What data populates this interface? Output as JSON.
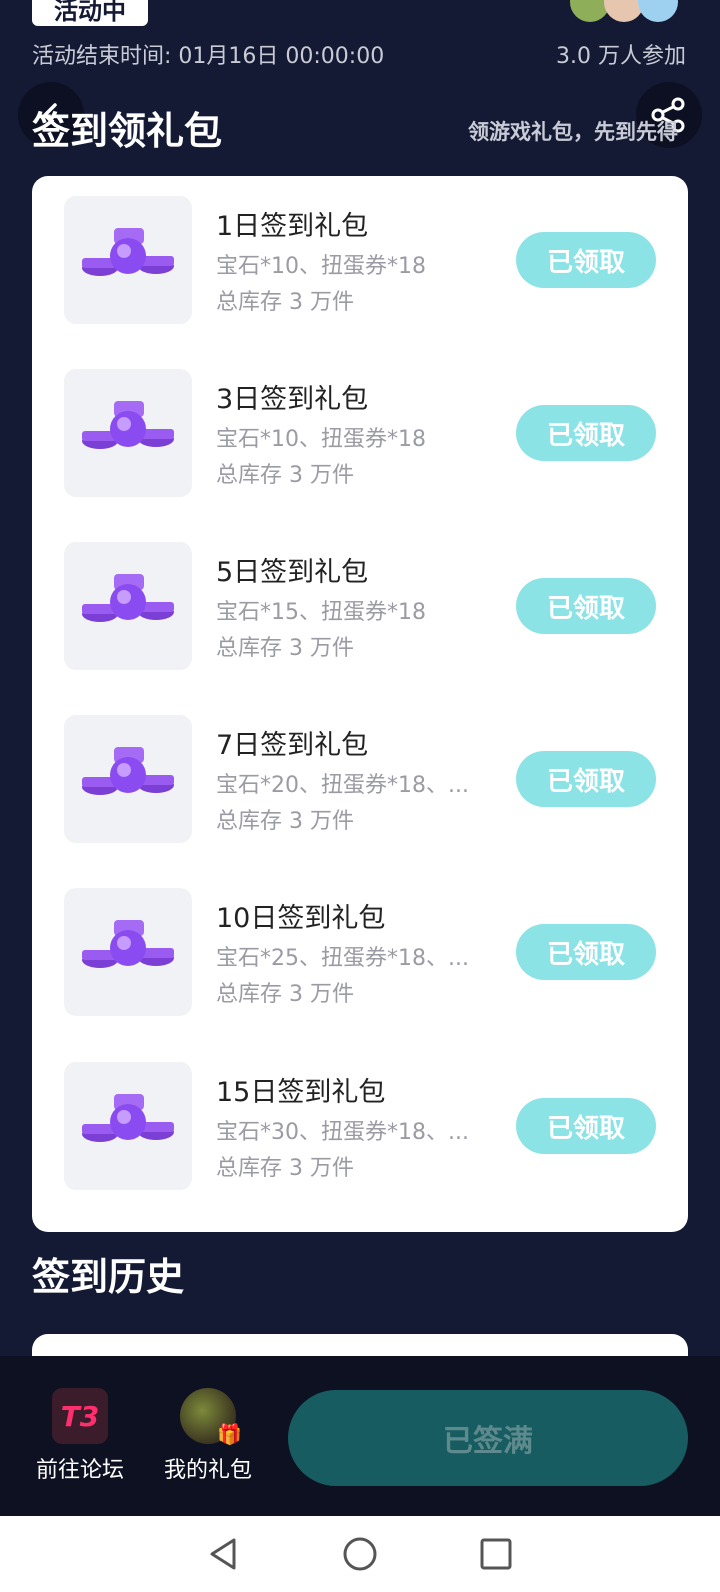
{
  "header": {
    "status_badge": "活动中",
    "end_time": "活动结束时间: 01月16日 00:00:00",
    "participants": "3.0 万人参加"
  },
  "checkin_section": {
    "title": "签到领礼包",
    "subtitle": "领游戏礼包，先到先得"
  },
  "gifts": [
    {
      "name": "1日签到礼包",
      "desc": "宝石*10、扭蛋券*18",
      "stock": "总库存 3 万件",
      "button": "已领取"
    },
    {
      "name": "3日签到礼包",
      "desc": "宝石*10、扭蛋券*18",
      "stock": "总库存 3 万件",
      "button": "已领取"
    },
    {
      "name": "5日签到礼包",
      "desc": "宝石*15、扭蛋券*18",
      "stock": "总库存 3 万件",
      "button": "已领取"
    },
    {
      "name": "7日签到礼包",
      "desc": "宝石*20、扭蛋券*18、...",
      "stock": "总库存 3 万件",
      "button": "已领取"
    },
    {
      "name": "10日签到礼包",
      "desc": "宝石*25、扭蛋券*18、...",
      "stock": "总库存 3 万件",
      "button": "已领取"
    },
    {
      "name": "15日签到礼包",
      "desc": "宝石*30、扭蛋券*18、...",
      "stock": "总库存 3 万件",
      "button": "已领取"
    }
  ],
  "history_section": {
    "title": "签到历史"
  },
  "bottom_bar": {
    "forum_logo_text": "T3",
    "forum_label": "前往论坛",
    "my_gift_label": "我的礼包",
    "main_button": "已签满"
  },
  "colors": {
    "background": "#141a33",
    "accent": "#8ce3e6",
    "main_button": "#175c61"
  },
  "icons": [
    "back-arrow-icon",
    "share-icon",
    "gem-icon",
    "gift-icon",
    "nav-back-icon",
    "nav-home-icon",
    "nav-recents-icon"
  ]
}
